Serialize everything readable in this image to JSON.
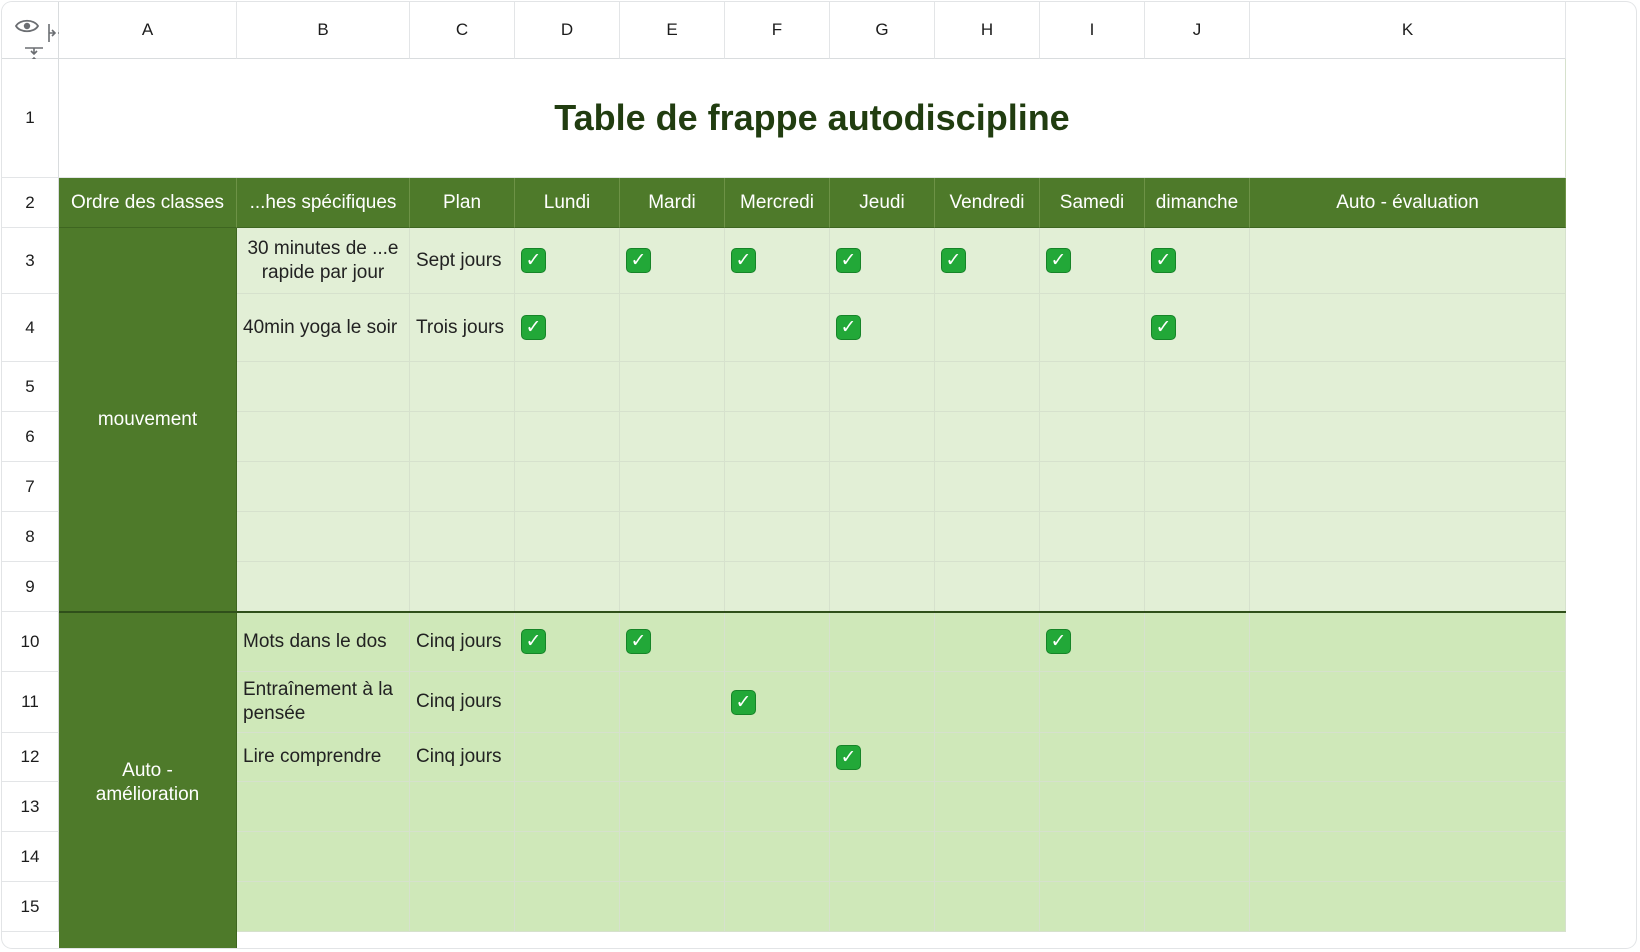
{
  "columns": [
    "A",
    "B",
    "C",
    "D",
    "E",
    "F",
    "G",
    "H",
    "I",
    "J",
    "K"
  ],
  "rows": [
    "1",
    "2",
    "3",
    "4",
    "5",
    "6",
    "7",
    "8",
    "9",
    "10",
    "11",
    "12",
    "13",
    "14",
    "15"
  ],
  "title": "Table de frappe autodiscipline",
  "headers": [
    "Ordre des classes",
    "...hes spécifiques",
    "Plan",
    "Lundi",
    "Mardi",
    "Mercredi",
    "Jeudi",
    "Vendredi",
    "Samedi",
    "dimanche",
    "Auto - évaluation"
  ],
  "categories": [
    "mouvement",
    "Auto - amélioration"
  ],
  "tasks": [
    {
      "task": "30 minutes de ...e rapide par jour",
      "plan": "Sept jours",
      "checks": [
        true,
        true,
        true,
        true,
        true,
        true,
        true
      ]
    },
    {
      "task": "40min yoga le soir",
      "plan": "Trois jours",
      "checks": [
        true,
        false,
        false,
        true,
        false,
        false,
        true
      ]
    },
    {
      "task": "",
      "plan": "",
      "checks": [
        false,
        false,
        false,
        false,
        false,
        false,
        false
      ]
    },
    {
      "task": "",
      "plan": "",
      "checks": [
        false,
        false,
        false,
        false,
        false,
        false,
        false
      ]
    },
    {
      "task": "",
      "plan": "",
      "checks": [
        false,
        false,
        false,
        false,
        false,
        false,
        false
      ]
    },
    {
      "task": "",
      "plan": "",
      "checks": [
        false,
        false,
        false,
        false,
        false,
        false,
        false
      ]
    },
    {
      "task": "",
      "plan": "",
      "checks": [
        false,
        false,
        false,
        false,
        false,
        false,
        false
      ]
    },
    {
      "task": "Mots dans le dos",
      "plan": "Cinq jours",
      "checks": [
        true,
        true,
        false,
        false,
        false,
        true,
        false
      ]
    },
    {
      "task": "Entraînement à la pensée",
      "plan": "Cinq jours",
      "checks": [
        false,
        false,
        true,
        false,
        false,
        false,
        false
      ]
    },
    {
      "task": "Lire comprendre",
      "plan": "Cinq jours",
      "checks": [
        false,
        false,
        false,
        true,
        false,
        false,
        false
      ]
    },
    {
      "task": "",
      "plan": "",
      "checks": [
        false,
        false,
        false,
        false,
        false,
        false,
        false
      ]
    },
    {
      "task": "",
      "plan": "",
      "checks": [
        false,
        false,
        false,
        false,
        false,
        false,
        false
      ]
    },
    {
      "task": "",
      "plan": "",
      "checks": [
        false,
        false,
        false,
        false,
        false,
        false,
        false
      ]
    }
  ],
  "check_symbol": "✓",
  "icons": {
    "view": "eye-icon",
    "col_resize": "column-resize-icon",
    "row_resize": "row-resize-icon"
  },
  "colors": {
    "header_green": "#4e7a2a",
    "band1": "#e2efd6",
    "band2": "#cfe8b9",
    "title": "#213d10",
    "check": "#22a838"
  }
}
